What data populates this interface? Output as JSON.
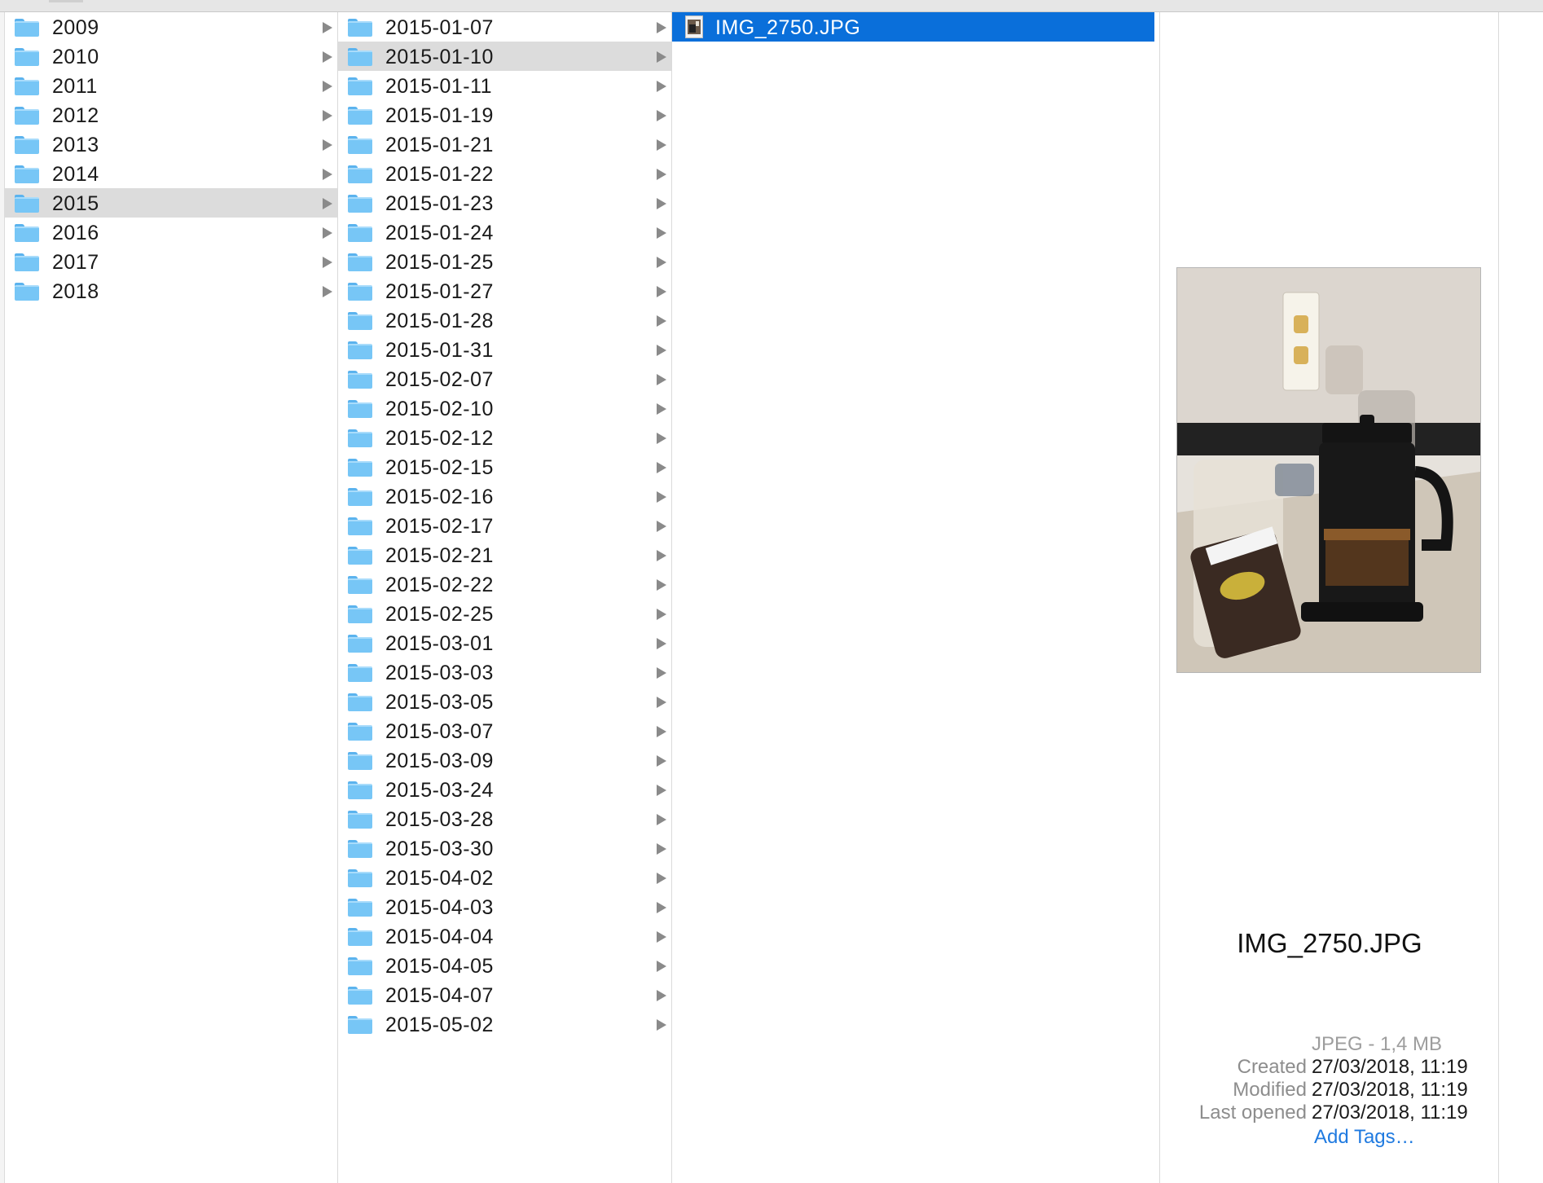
{
  "columns": {
    "years": {
      "selected_index": 6,
      "items": [
        "2009",
        "2010",
        "2011",
        "2012",
        "2013",
        "2014",
        "2015",
        "2016",
        "2017",
        "2018"
      ]
    },
    "dates": {
      "selected_index": 1,
      "items": [
        "2015-01-07",
        "2015-01-10",
        "2015-01-11",
        "2015-01-19",
        "2015-01-21",
        "2015-01-22",
        "2015-01-23",
        "2015-01-24",
        "2015-01-25",
        "2015-01-27",
        "2015-01-28",
        "2015-01-31",
        "2015-02-07",
        "2015-02-10",
        "2015-02-12",
        "2015-02-15",
        "2015-02-16",
        "2015-02-17",
        "2015-02-21",
        "2015-02-22",
        "2015-02-25",
        "2015-03-01",
        "2015-03-03",
        "2015-03-05",
        "2015-03-07",
        "2015-03-09",
        "2015-03-24",
        "2015-03-28",
        "2015-03-30",
        "2015-04-02",
        "2015-04-03",
        "2015-04-04",
        "2015-04-05",
        "2015-04-07",
        "2015-05-02"
      ]
    },
    "files": {
      "selected_index": 0,
      "items": [
        "IMG_2750.JPG"
      ]
    }
  },
  "preview": {
    "file_name": "IMG_2750.JPG",
    "kind_size": "JPEG - 1,4 MB",
    "created_label": "Created",
    "created_value": "27/03/2018, 11:19",
    "modified_label": "Modified",
    "modified_value": "27/03/2018, 11:19",
    "last_opened_label": "Last opened",
    "last_opened_value": "27/03/2018, 11:19",
    "add_tags": "Add Tags…"
  },
  "colors": {
    "selection_blue": "#0a6fda",
    "selection_gray": "#dcdcdc",
    "folder_blue": "#77c6f6",
    "link_blue": "#1f7ae0"
  },
  "icons": {
    "folder": "folder-icon",
    "disclosure": "disclosure-arrow-icon",
    "image_file": "image-file-icon"
  }
}
